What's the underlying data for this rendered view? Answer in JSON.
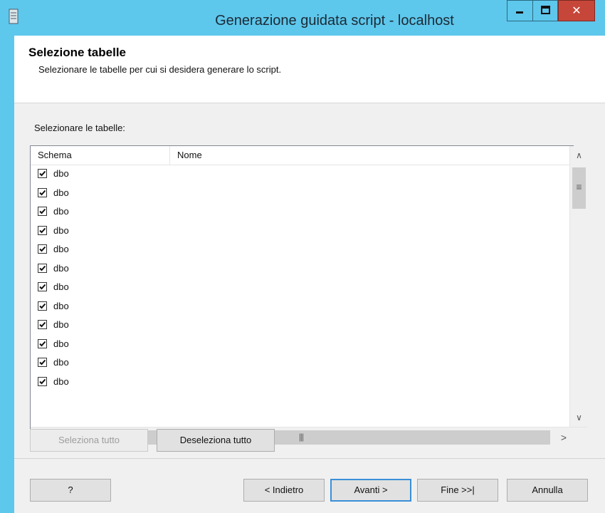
{
  "window": {
    "title": "Generazione guidata script - localhost",
    "titlebar_color": "#5ec7ec",
    "close_color": "#c7463a"
  },
  "header": {
    "title": "Selezione tabelle",
    "subtitle": "Selezionare le tabelle per cui si desidera generare lo script."
  },
  "list": {
    "label": "Selezionare le tabelle:",
    "columns": [
      "Schema",
      "Nome"
    ],
    "rows": [
      {
        "schema": "dbo",
        "checked": true
      },
      {
        "schema": "dbo",
        "checked": true
      },
      {
        "schema": "dbo",
        "checked": true
      },
      {
        "schema": "dbo",
        "checked": true
      },
      {
        "schema": "dbo",
        "checked": true
      },
      {
        "schema": "dbo",
        "checked": true
      },
      {
        "schema": "dbo",
        "checked": true
      },
      {
        "schema": "dbo",
        "checked": true
      },
      {
        "schema": "dbo",
        "checked": true
      },
      {
        "schema": "dbo",
        "checked": true
      },
      {
        "schema": "dbo",
        "checked": true
      },
      {
        "schema": "dbo",
        "checked": true
      }
    ]
  },
  "buttons": {
    "select_all": "Seleziona tutto",
    "deselect_all": "Deseleziona tutto",
    "help": "?",
    "back": "< Indietro",
    "next": "Avanti >",
    "finish": "Fine >>|",
    "cancel": "Annulla"
  },
  "icons": {
    "app": "server-icon",
    "minimize": "minimize-icon",
    "maximize": "maximize-icon",
    "close": "close-icon"
  }
}
